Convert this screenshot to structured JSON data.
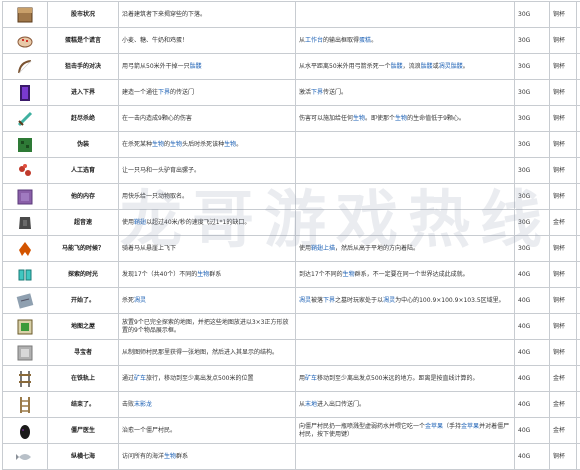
{
  "rows": [
    {
      "icon": "block-icon",
      "color": "#a0784a",
      "title": "股市状况",
      "desc": "沿着建筑者下来揭穿些的下落。",
      "cond": "",
      "pts": "30G",
      "trophy": "铜杯"
    },
    {
      "icon": "cake-icon",
      "color": "#e8c9a8",
      "title": "蛋糕是个谎言",
      "desc": "小麦、糖、牛奶和鸡蛋！",
      "cond": "从工作台的输出框取得蛋糕。",
      "pts": "30G",
      "trophy": "铜杯"
    },
    {
      "icon": "bow-icon",
      "color": "#7a5230",
      "title": "狙击手的对决",
      "desc": "用弓箭从50米外干掉一只骷髅",
      "cond": "从水平距离50米外用弓箭杀死一个骷髅，流浪骷髅或凋灵骷髅。",
      "pts": "30G",
      "trophy": "铜杯"
    },
    {
      "icon": "portal-icon",
      "color": "#3a1a6a",
      "title": "进入下界",
      "desc": "建造一个通往下界的传送门",
      "cond": "激活下界传送门。",
      "pts": "30G",
      "trophy": "铜杯"
    },
    {
      "icon": "sword-icon",
      "color": "#3fb0a0",
      "title": "赶尽杀绝",
      "desc": "在一击内造成9颗心的伤害",
      "cond": "伤害可以施加给任何生物。即使那个生物的生命值低于9颗心。",
      "pts": "30G",
      "trophy": "铜杯"
    },
    {
      "icon": "leaves-icon",
      "color": "#2e7a36",
      "title": "伪装",
      "desc": "在杀死某种生物的生物头后时杀死该种生物。",
      "cond": "",
      "pts": "30G",
      "trophy": "铜杯"
    },
    {
      "icon": "redstone-icon",
      "color": "#c0392b",
      "title": "人工选育",
      "desc": "让一只马和一头驴育出骡子。",
      "cond": "",
      "pts": "30G",
      "trophy": "铜杯"
    },
    {
      "icon": "purpur-icon",
      "color": "#8a5fa8",
      "title": "他的内存",
      "desc": "用快乐给一只动物取名。",
      "cond": "",
      "pts": "30G",
      "trophy": "铜杯"
    },
    {
      "icon": "armor-icon",
      "color": "#4a4a4a",
      "title": "超音速",
      "desc": "使用鞘翅以超过40米/秒的速度飞过1*1的缺口。",
      "cond": "",
      "pts": "30G",
      "trophy": "金杯"
    },
    {
      "icon": "elytra-icon",
      "color": "#d35400",
      "title": "马能飞的时候？",
      "desc": "骑着马从悬崖上飞下",
      "cond": "使用鞘翅上描，然后从高于平地的方向着陆。",
      "pts": "30G",
      "trophy": "铜杯"
    },
    {
      "icon": "boots-icon",
      "color": "#3fc6c0",
      "title": "探索的时光",
      "desc": "发现17个（共40个）不同的生物群系",
      "cond": "到达17个不同的生物群系，不一定要在同一个世界达成此成就。",
      "pts": "40G",
      "trophy": "铜杯"
    },
    {
      "icon": "map-icon",
      "color": "#8fa0b0",
      "title": "开始了。",
      "desc": "杀死凋灵",
      "cond": "凋灵被落下界之墓时玩家处于以凋灵为中心的100.9×100.9×103.5区域里。",
      "pts": "40G",
      "trophy": "铜杯"
    },
    {
      "icon": "chart-icon",
      "color": "#3a9a3a",
      "title": "地图之屋",
      "desc": "放置9个已完全探索的地图，并把这些地图放进以3×3正方形放置的9个物品展示框。",
      "cond": "",
      "pts": "40G",
      "trophy": "铜杯"
    },
    {
      "icon": "chest-icon",
      "color": "#b0b0b0",
      "title": "寻宝者",
      "desc": "从制图师村民那里获得一张地图，然后进入其显示的结构。",
      "cond": "",
      "pts": "40G",
      "trophy": "铜杯"
    },
    {
      "icon": "rail-icon",
      "color": "#8a6a3a",
      "title": "在铁轨上",
      "desc": "通过矿车旅行，移动到至少离出发点500米的位置",
      "cond": "用矿车移动到至少离出发点500米远的地方。距离是按直线计算的。",
      "pts": "40G",
      "trophy": "金杯"
    },
    {
      "icon": "ladder-icon",
      "color": "#9a7a4a",
      "title": "结束了。",
      "desc": "击败末影龙",
      "cond": "从末地进入出口传送门。",
      "pts": "40G",
      "trophy": "金杯"
    },
    {
      "icon": "egg-icon",
      "color": "#1a1a1a",
      "title": "僵尸医生",
      "desc": "治愈一个僵尸村民。",
      "cond": "向僵尸村民扔一瓶喷溅型虚弱药水并喂它吃一个金苹果（手持金苹果并对着僵尸村民，按下使用键）",
      "pts": "40G",
      "trophy": "金杯"
    },
    {
      "icon": "fish-icon",
      "color": "#b8c0c8",
      "title": "纵横七海",
      "desc": "访问所有的海洋生物群系",
      "cond": "",
      "pts": "40G",
      "trophy": "铜杯"
    }
  ],
  "watermark": "龙哥游戏热线"
}
